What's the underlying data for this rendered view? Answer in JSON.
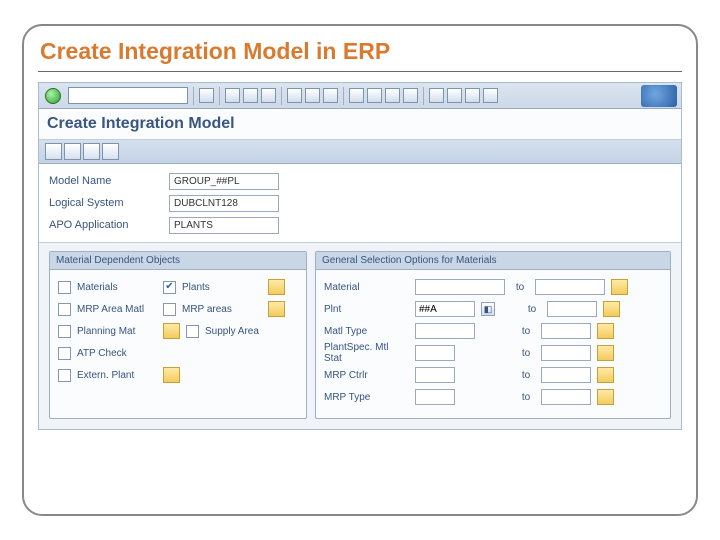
{
  "slide": {
    "title": "Create Integration Model in ERP"
  },
  "toolbar": {
    "ok_icon": "ok-check-icon",
    "save_icon": "save-icon",
    "back_icon": "back-icon"
  },
  "screen": {
    "title": "Create Integration Model"
  },
  "header": {
    "model_label": "Model Name",
    "model_value": "GROUP_##PL",
    "logsys_label": "Logical System",
    "logsys_value": "DUBCLNT128",
    "apoapp_label": "APO Application",
    "apoapp_value": "PLANTS"
  },
  "group_mdo": {
    "title": "Material Dependent Objects",
    "rows": [
      {
        "col1_label": "Materials",
        "col1_checked": false,
        "col2_label": "Plants",
        "col2_checked": true,
        "col2_match": true
      },
      {
        "col1_label": "MRP Area Matl",
        "col1_checked": false,
        "col2_label": "MRP areas",
        "col2_checked": false,
        "col2_match": true
      },
      {
        "col1_label": "Planning Mat",
        "col1_checked": false,
        "col1_match": true,
        "col2_label": "Supply Area",
        "col2_checked": false
      },
      {
        "col1_label": "ATP Check",
        "col1_checked": false
      },
      {
        "col1_label": "Extern. Plant",
        "col1_checked": false,
        "col1_match": true
      }
    ]
  },
  "group_gso": {
    "title": "General Selection Options for Materials",
    "to_label": "to",
    "rows": [
      {
        "label": "Material",
        "from": "",
        "to": ""
      },
      {
        "label": "Plnt",
        "from": "##A",
        "to": "",
        "f4": true
      },
      {
        "label": "Matl Type",
        "from": "",
        "to": ""
      },
      {
        "label": "PlantSpec. Mtl Stat",
        "from": "",
        "to": ""
      },
      {
        "label": "MRP Ctrlr",
        "from": "",
        "to": ""
      },
      {
        "label": "MRP Type",
        "from": "",
        "to": ""
      }
    ]
  }
}
